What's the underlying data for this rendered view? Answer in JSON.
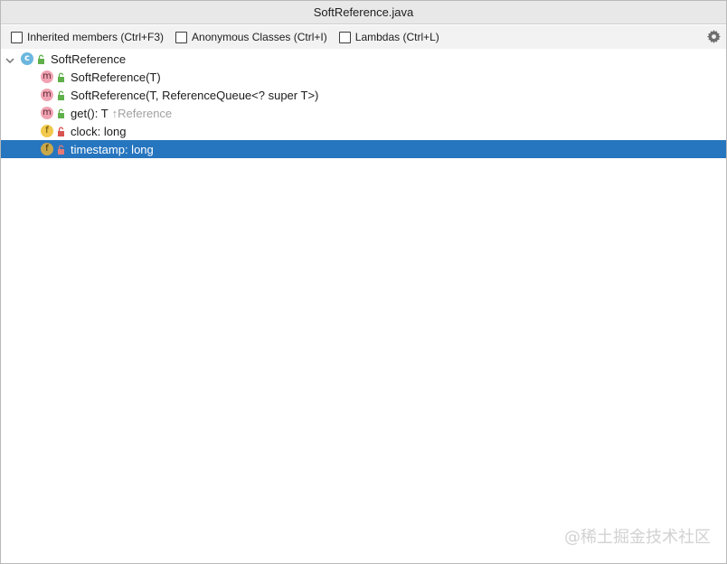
{
  "window": {
    "title": "SoftReference.java"
  },
  "toolbar": {
    "checkboxes": [
      {
        "label": "Inherited members (Ctrl+F3)",
        "checked": false
      },
      {
        "label": "Anonymous Classes (Ctrl+I)",
        "checked": false
      },
      {
        "label": "Lambdas (Ctrl+L)",
        "checked": false
      }
    ],
    "settings_icon": "gear-icon"
  },
  "tree": {
    "root": {
      "name": "SoftReference",
      "icon": "class-icon",
      "icon_letter": "c",
      "expanded": true
    },
    "members": [
      {
        "name": "SoftReference(T)",
        "kind": "method",
        "icon_letter": "m",
        "visibility": "public",
        "hint": "",
        "selected": false
      },
      {
        "name": "SoftReference(T, ReferenceQueue<? super T>)",
        "kind": "method",
        "icon_letter": "m",
        "visibility": "public",
        "hint": "",
        "selected": false
      },
      {
        "name": "get(): T",
        "kind": "method",
        "icon_letter": "m",
        "visibility": "public",
        "hint": "↑Reference",
        "selected": false
      },
      {
        "name": "clock: long",
        "kind": "field",
        "icon_letter": "f",
        "visibility": "private",
        "hint": "",
        "selected": false
      },
      {
        "name": "timestamp: long",
        "kind": "field",
        "icon_letter": "f",
        "visibility": "private",
        "hint": "",
        "selected": true
      }
    ]
  },
  "watermark": "@稀土掘金技术社区",
  "colors": {
    "selection": "#2675bf",
    "class_icon": "#6bb7de",
    "method_icon": "#f1a2b2",
    "field_icon": "#f2c94c",
    "public_lock": "#5fb04b",
    "private_lock": "#d9534f"
  }
}
